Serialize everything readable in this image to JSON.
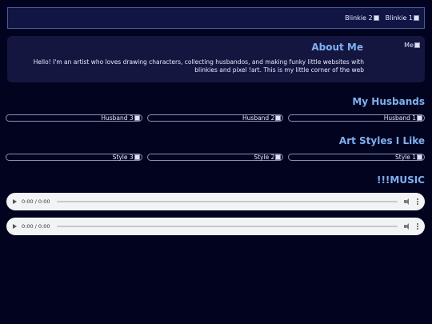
{
  "banner": {
    "blinkies": [
      {
        "label": "Blinkie 2"
      },
      {
        "label": "Blinkie 1"
      }
    ]
  },
  "about": {
    "title": "About Me",
    "image_alt": "Me",
    "text": "Hello! I'm an artist who loves drawing characters, collecting husbandos, and making funky little websites with blinkies and pixel !art. This is my little corner of the web"
  },
  "husbands": {
    "title": "My Husbands",
    "items": [
      {
        "label": "Husband 3"
      },
      {
        "label": "Husband 2"
      },
      {
        "label": "Husband 1"
      }
    ]
  },
  "styles": {
    "title": "Art Styles I Like",
    "items": [
      {
        "label": "Style 3"
      },
      {
        "label": "Style 2"
      },
      {
        "label": "Style 1"
      }
    ]
  },
  "music": {
    "title": "!!!MUSIC",
    "players": [
      {
        "time": "0:00 / 0:00"
      },
      {
        "time": "0:00 / 0:00"
      }
    ]
  },
  "colors": {
    "background": "#02041f",
    "panel": "#141640",
    "heading": "#7fb0f0"
  }
}
